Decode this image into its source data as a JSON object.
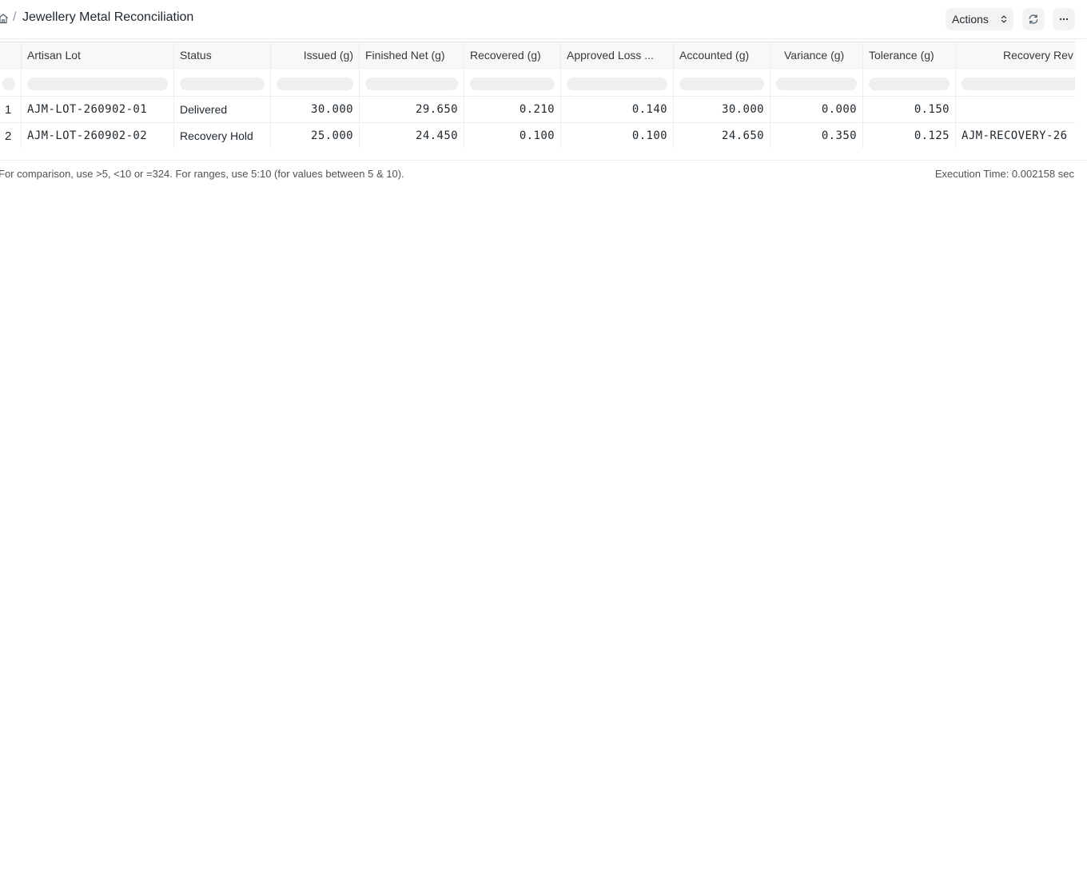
{
  "header": {
    "home_icon": "home-icon",
    "separator": "/",
    "title": "Jewellery Metal Reconciliation",
    "actions_label": "Actions",
    "refresh_icon": "refresh-icon",
    "more_icon": "more-horizontal-icon"
  },
  "table": {
    "columns": [
      "Artisan Lot",
      "Status",
      "Issued (g)",
      "Finished Net (g)",
      "Recovered (g)",
      "Approved Loss ...",
      "Accounted (g)",
      "Variance (g)",
      "Tolerance (g)",
      "Recovery Rev"
    ],
    "rows": [
      {
        "index": "1",
        "artisan_lot": "AJM-LOT-260902-01",
        "status": "Delivered",
        "issued": "30.000",
        "finished_net": "29.650",
        "recovered": "0.210",
        "approved_loss": "0.140",
        "accounted": "30.000",
        "variance": "0.000",
        "tolerance": "0.150",
        "recovery_rev": ""
      },
      {
        "index": "2",
        "artisan_lot": "AJM-LOT-260902-02",
        "status": "Recovery Hold",
        "issued": "25.000",
        "finished_net": "24.450",
        "recovered": "0.100",
        "approved_loss": "0.100",
        "accounted": "24.650",
        "variance": "0.350",
        "tolerance": "0.125",
        "recovery_rev": "AJM-RECOVERY-26"
      }
    ]
  },
  "footer": {
    "filter_hint": "For comparison, use >5, <10 or =324. For ranges, use 5:10 (for values between 5 & 10).",
    "execution_time": "Execution Time: 0.002158 sec"
  }
}
